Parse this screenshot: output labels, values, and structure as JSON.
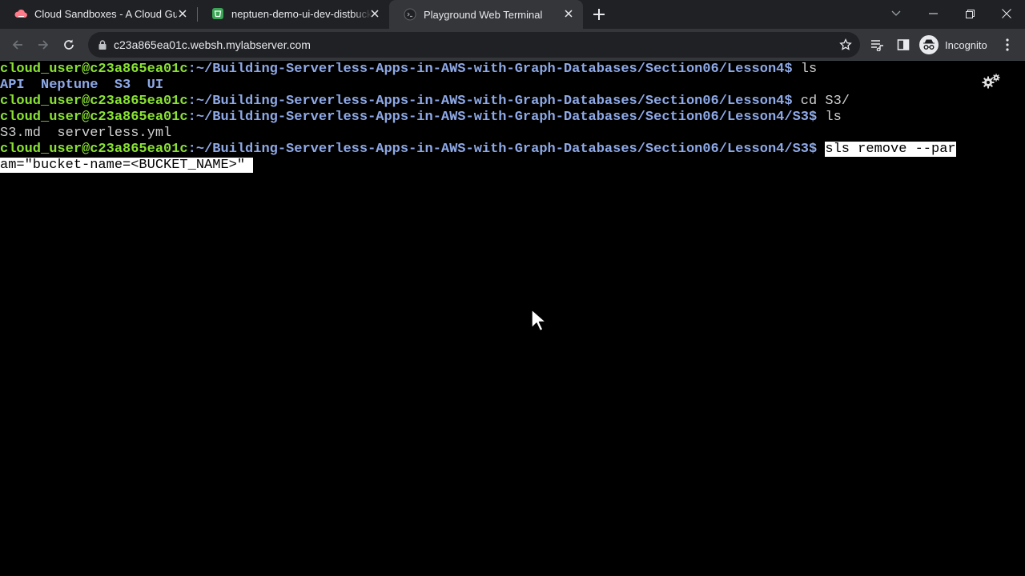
{
  "tabs": [
    {
      "title": "Cloud Sandboxes - A Cloud Guru",
      "favicon": "cloud-icon",
      "active": false
    },
    {
      "title": "neptuen-demo-ui-dev-distbucket",
      "favicon": "bucket-icon",
      "active": false
    },
    {
      "title": "Playground Web Terminal",
      "favicon": "terminal-icon",
      "active": true
    }
  ],
  "address_bar": {
    "url": "c23a865ea01c.websh.mylabserver.com"
  },
  "profile": {
    "label": "Incognito"
  },
  "terminal": {
    "lines": [
      {
        "user_host": "cloud_user@c23a865ea01c",
        "sep": ":",
        "path": "~/Building-Serverless-Apps-in-AWS-with-Graph-Databases/Section06/Lesson4",
        "prompt": "$",
        "cmd": " ls"
      },
      {
        "output": [
          "API",
          "Neptune",
          "S3",
          "UI"
        ]
      },
      {
        "user_host": "cloud_user@c23a865ea01c",
        "sep": ":",
        "path": "~/Building-Serverless-Apps-in-AWS-with-Graph-Databases/Section06/Lesson4",
        "prompt": "$",
        "cmd": " cd S3/"
      },
      {
        "user_host": "cloud_user@c23a865ea01c",
        "sep": ":",
        "path": "~/Building-Serverless-Apps-in-AWS-with-Graph-Databases/Section06/Lesson4/S3",
        "prompt": "$",
        "cmd": " ls"
      },
      {
        "plain_output": "S3.md  serverless.yml"
      },
      {
        "user_host": "cloud_user@c23a865ea01c",
        "sep": ":",
        "path": "~/Building-Serverless-Apps-in-AWS-with-Graph-Databases/Section06/Lesson4/S3",
        "prompt": "$",
        "cmd_selected": "sls remove --par"
      },
      {
        "selected_wrap": "am=\"bucket-name=<BUCKET_NAME>\" "
      }
    ]
  },
  "colors": {
    "user_host": "#8ae234",
    "path": "#8ea9e6",
    "selection_bg": "#ffffff",
    "background": "#000000"
  }
}
